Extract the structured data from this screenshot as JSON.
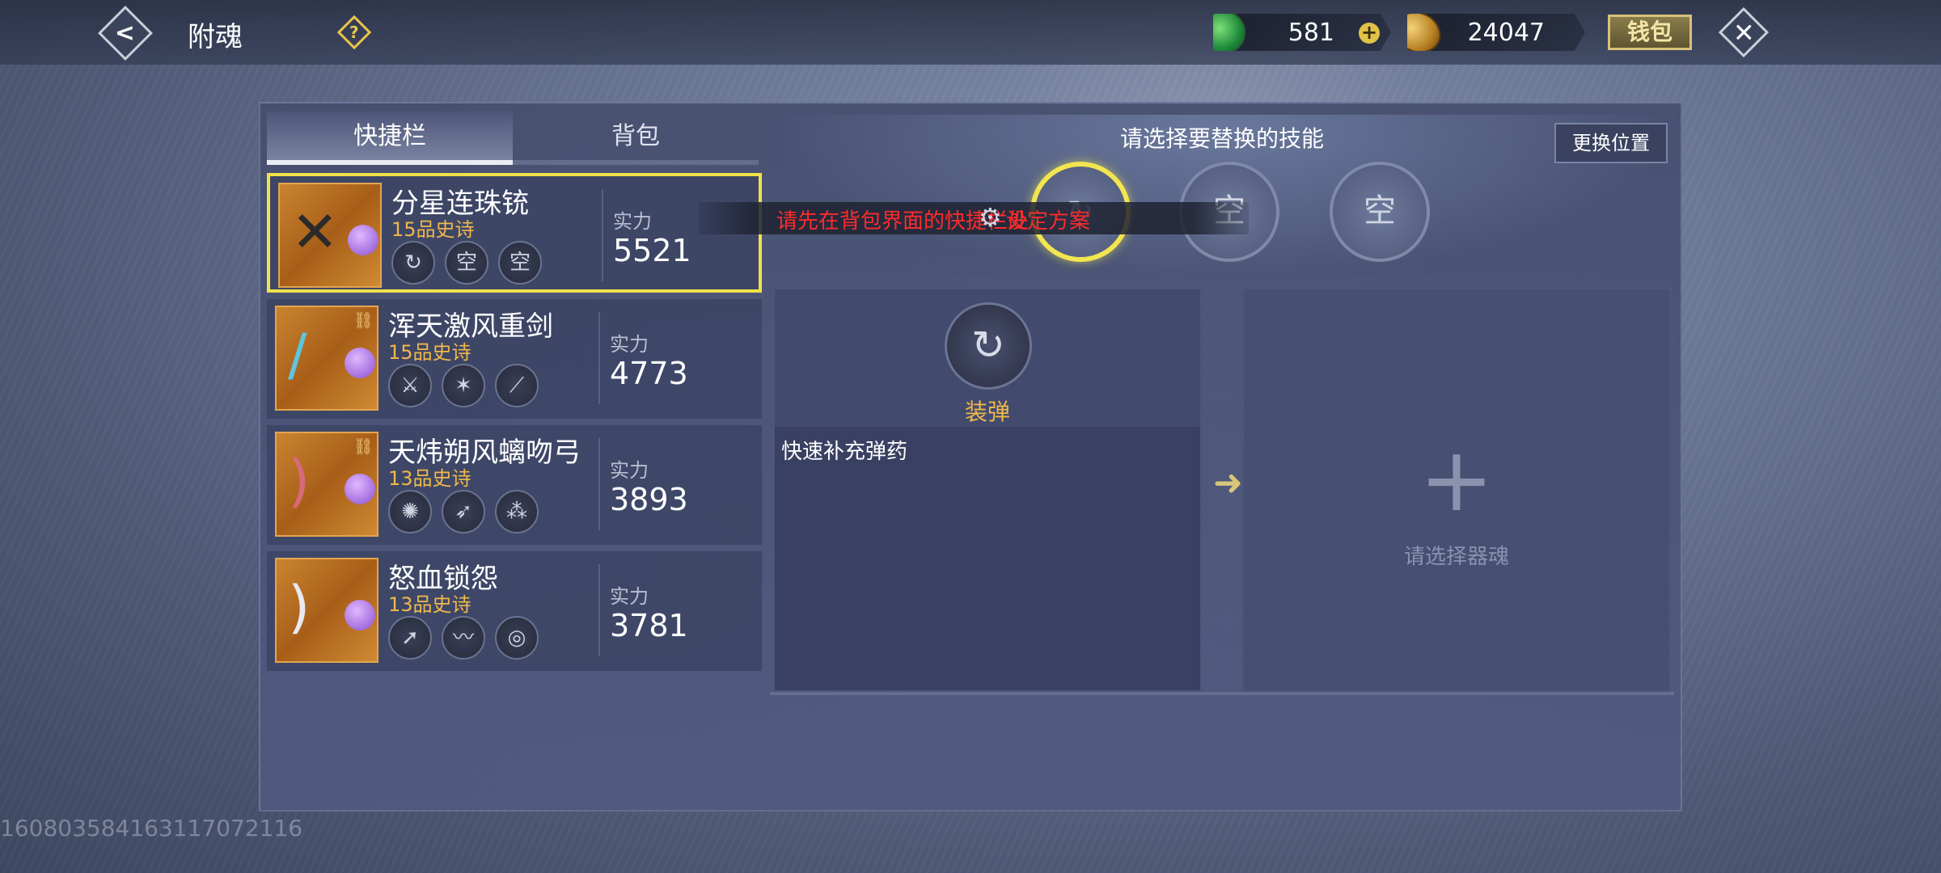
{
  "header": {
    "title": "附魂",
    "help_label": "?",
    "back_label": "<",
    "close_label": "✕",
    "wallet_label": "钱包"
  },
  "currency": {
    "jade": "581",
    "plus": "+",
    "coins": "24047"
  },
  "tabs": [
    "快捷栏",
    "背包"
  ],
  "weapons": [
    {
      "name": "分星连珠铳",
      "grade": "15品史诗",
      "power_label": "实力",
      "power": "5521",
      "slots": [
        "",
        "空",
        "空"
      ],
      "selected": true
    },
    {
      "name": "浑天激风重剑",
      "grade": "15品史诗",
      "power_label": "实力",
      "power": "4773",
      "slots": [
        "",
        "",
        ""
      ],
      "selected": false
    },
    {
      "name": "天炜朔风螭吻弓",
      "grade": "13品史诗",
      "power_label": "实力",
      "power": "3893",
      "slots": [
        "",
        "",
        ""
      ],
      "selected": false
    },
    {
      "name": "怒血锁怨",
      "grade": "13品史诗",
      "power_label": "实力",
      "power": "3781",
      "slots": [
        "",
        "",
        ""
      ],
      "selected": false
    }
  ],
  "skill_panel": {
    "title": "请选择要替换的技能",
    "swap_button": "更换位置",
    "slots": [
      "",
      "空",
      "空"
    ],
    "warning": "请先在背包界面的快捷栏处",
    "warning_tail": "设定方案",
    "skill_name": "装弹",
    "skill_desc": "快速补充弹药",
    "soul_label": "请选择器魂",
    "plus": "+",
    "arrow": "➜"
  },
  "uid": "1608035841631170721​16",
  "colors": {
    "accent_gold": "#f0b84a",
    "warning_red": "#ff2b2b",
    "selected_border": "#f0e24a"
  }
}
